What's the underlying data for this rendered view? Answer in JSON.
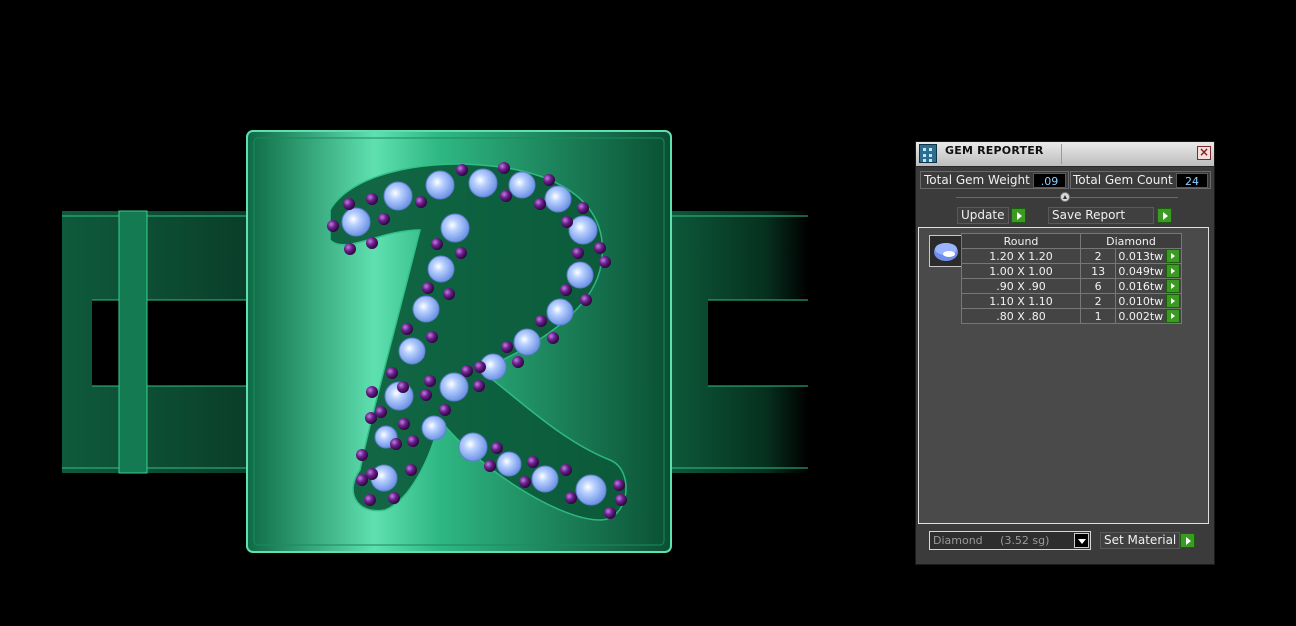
{
  "panel": {
    "title": "GEM REPORTER",
    "total_weight_label": "Total Gem Weight",
    "total_weight_value": ".09",
    "total_count_label": "Total Gem Count",
    "total_count_value": "24",
    "update_label": "Update",
    "save_label": "Save Report",
    "shape_header": "Round",
    "material_header": "Diamond",
    "rows": [
      {
        "size": "1.20 X 1.20",
        "count": "2",
        "weight": "0.013tw"
      },
      {
        "size": "1.00 X 1.00",
        "count": "13",
        "weight": "0.049tw"
      },
      {
        "size": ".90 X .90",
        "count": "6",
        "weight": "0.016tw"
      },
      {
        "size": "1.10 X 1.10",
        "count": "2",
        "weight": "0.010tw"
      },
      {
        "size": ".80 X .80",
        "count": "1",
        "weight": "0.002tw"
      }
    ],
    "material_select": "Diamond     (3.52 sg)",
    "set_material_label": "Set Material"
  },
  "colors": {
    "ring_green": "#1f8f5e",
    "gem_blue": "#8fb6ff",
    "gem_purple": "#6a1f8a",
    "accent_go": "#3a9a22"
  }
}
